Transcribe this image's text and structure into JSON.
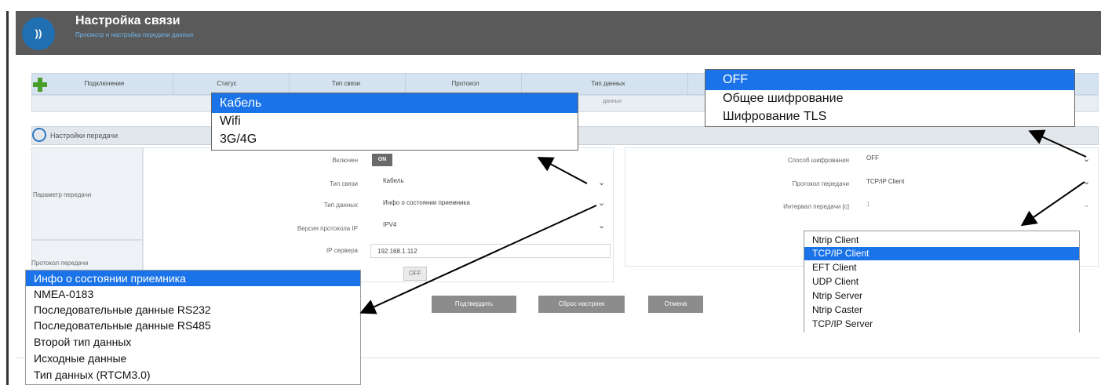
{
  "header": {
    "title": "Настройка связи",
    "subtitle": "Просмотр и настройка передачи данных",
    "logo_glyph": "\u0001"
  },
  "table": {
    "columns": [
      "Подключение",
      "Статус",
      "Тип связи",
      "Протокол",
      "Тип данных"
    ],
    "sub_text": "данных"
  },
  "section": {
    "title": "Настройки передачи"
  },
  "left_labels": {
    "params": "Параметр передачи",
    "protocol": "Протокол передачи"
  },
  "form_left": {
    "enabled_label": "Включен",
    "enabled_value": "ON",
    "link_type_label": "Тип связи",
    "link_type_value": "Кабель",
    "data_type_label": "Тип данных",
    "data_type_value": "Инфо о состоянии приемника",
    "ip_version_label": "Версия протокола IP",
    "ip_version_value": "IPV4",
    "server_ip_label": "IP сервера",
    "server_ip_value": "192.168.1.112",
    "off_toggle": "OFF"
  },
  "form_right": {
    "encryption_label": "Способ шифрования",
    "encryption_value": "OFF",
    "protocol_label": "Протокол передачи",
    "protocol_value": "TCP/IP Client",
    "interval_label": "Интервал передачи [с]",
    "interval_value": "1"
  },
  "buttons": {
    "confirm": "Подтвердить",
    "reset": "Сброс настроек",
    "cancel": "Отмена"
  },
  "dropdowns": {
    "link_type": {
      "items": [
        "Кабель",
        "Wifi",
        "3G/4G"
      ],
      "selected_index": 0
    },
    "encryption": {
      "items": [
        "OFF",
        "Общее шифрование",
        "Шифрование TLS"
      ],
      "selected_index": 0
    },
    "data_type": {
      "items": [
        "Инфо о состоянии приемника",
        "NMEA-0183",
        "Последовательные данные RS232",
        "Последовательные данные RS485",
        "Второй тип данных",
        "Исходные данные",
        "Тип данных (RTCM3.0)"
      ],
      "selected_index": 0
    },
    "protocol": {
      "items": [
        "Ntrip Client",
        "TCP/IP Client",
        "EFT Client",
        "UDP Client",
        "Ntrip Server",
        "Ntrip Caster",
        "TCP/IP Server"
      ],
      "selected_index": 1
    }
  },
  "colors": {
    "header_bg": "#5a5a5a",
    "accent_blue": "#1a73e8",
    "plus_green": "#4a9e2a"
  }
}
